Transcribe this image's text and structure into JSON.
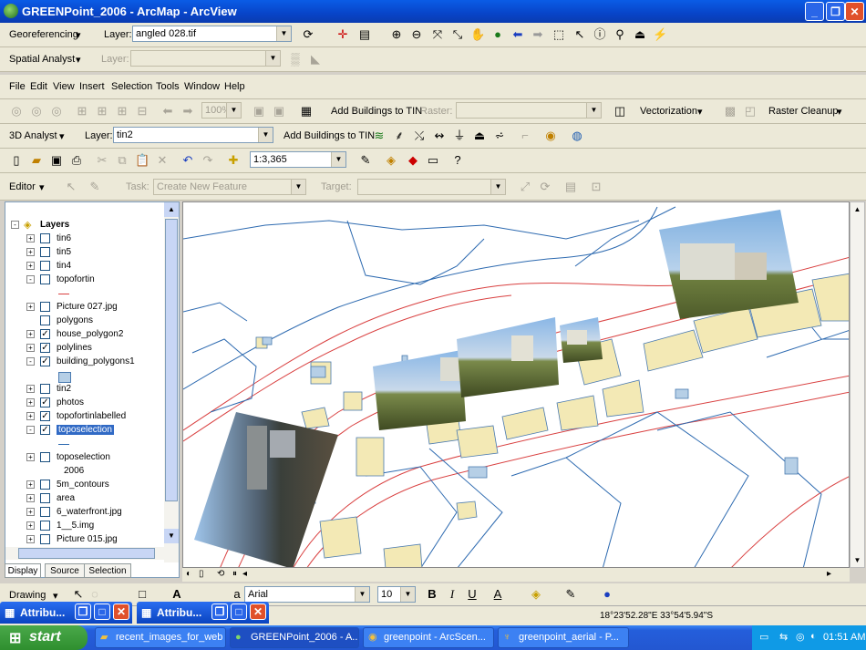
{
  "window": {
    "title": "GREENPoint_2006 - ArcMap - ArcView"
  },
  "georef": {
    "label": "Georeferencing",
    "layer_label": "Layer:",
    "layer_value": "angled 028.tif"
  },
  "spatial": {
    "label": "Spatial Analyst",
    "layer_label": "Layer:"
  },
  "menu": [
    "File",
    "Edit",
    "View",
    "Insert",
    "Selection",
    "Tools",
    "Window",
    "Help"
  ],
  "tin_bar": {
    "zoom": "100%",
    "add_buildings": "Add Buildings to TIN",
    "raster_label": "Raster:",
    "vectorization": "Vectorization",
    "raster_cleanup": "Raster Cleanup"
  },
  "analyst3d": {
    "label": "3D Analyst",
    "layer_label": "Layer:",
    "layer_value": "tin2",
    "add_buildings": "Add Buildings to TIN"
  },
  "standard": {
    "scale": "1:3,365"
  },
  "editor": {
    "label": "Editor",
    "task_label": "Task:",
    "task_value": "Create New Feature",
    "target_label": "Target:"
  },
  "toc": {
    "root": "Layers",
    "layers": [
      {
        "name": "tin6",
        "checked": false,
        "expand": "+"
      },
      {
        "name": "tin5",
        "checked": false,
        "expand": "+"
      },
      {
        "name": "tin4",
        "checked": false,
        "expand": "+"
      },
      {
        "name": "topofortin",
        "checked": false,
        "expand": "-"
      },
      {
        "name": "Picture 027.jpg",
        "checked": false,
        "expand": "+"
      },
      {
        "name": "polygons",
        "checked": false,
        "expand": ""
      },
      {
        "name": "house_polygon2",
        "checked": true,
        "expand": "+"
      },
      {
        "name": "polylines",
        "checked": true,
        "expand": "+"
      },
      {
        "name": "building_polygons1",
        "checked": true,
        "expand": "-"
      },
      {
        "name": "tin2",
        "checked": false,
        "expand": "+"
      },
      {
        "name": "photos",
        "checked": true,
        "expand": "+"
      },
      {
        "name": "topofortinlabelled",
        "checked": true,
        "expand": "+"
      },
      {
        "name": "toposelection",
        "checked": true,
        "expand": "-",
        "selected": true
      },
      {
        "name": "toposelection",
        "checked": false,
        "expand": "+"
      },
      {
        "name": "2006",
        "checked": false,
        "expand": "",
        "indent": true
      },
      {
        "name": "5m_contours",
        "checked": false,
        "expand": "+"
      },
      {
        "name": "area",
        "checked": false,
        "expand": "+"
      },
      {
        "name": "6_waterfront.jpg",
        "checked": false,
        "expand": "+"
      },
      {
        "name": "1__5.img",
        "checked": false,
        "expand": "+"
      },
      {
        "name": "Picture 015.jpg",
        "checked": false,
        "expand": "+"
      }
    ]
  },
  "tabs": {
    "display": "Display",
    "source": "Source",
    "selection": "Selection"
  },
  "draw": {
    "label": "Drawing",
    "font": "Arial",
    "size": "10"
  },
  "status": {
    "coords": "18°23'52.28\"E  33°54'5.94\"S"
  },
  "attr_windows": [
    "Attribu...",
    "Attribu..."
  ],
  "taskbar": {
    "start": "start",
    "tasks": [
      "recent_images_for_web",
      "GREENPoint_2006 - A...",
      "greenpoint - ArcScen...",
      "greenpoint_aerial - P..."
    ],
    "time": "01:51 AM"
  }
}
